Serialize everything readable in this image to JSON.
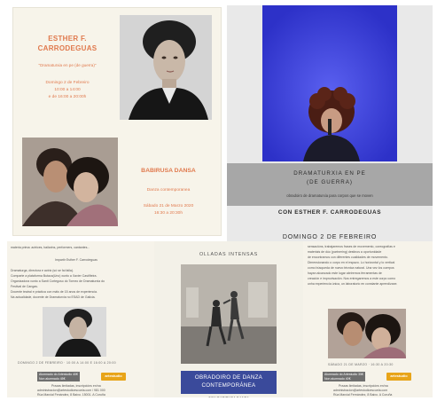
{
  "poster1": {
    "name_line1": "ESTHER F.",
    "name_line2": "CARRODEGUAS",
    "workshop_title": "\"Dramaturxia en pe (de guerra)\"",
    "date": "Domingo 2 de Febreiro",
    "time1": "10:00 a 14:00",
    "time2": "e de 16:00 a 20:00h",
    "company": "BABIRUSA DANSA",
    "genre": "Danza contemporanea",
    "date2": "Sábado 21 de Marzo 2020",
    "time3": "16:30 a 20:30h"
  },
  "poster2": {
    "title_line1": "DRAMATURXIA EN PE",
    "title_line2": "(DE GUERRA)",
    "subtitle": "obradoiro de dramaturxia para corpos que se moven",
    "instructor": "CON ESTHER F. CARRODEGUAS",
    "date": "DOMINGO 2 DE FEBREIRO"
  },
  "poster3": {
    "top_line": "materia prima: actrices, bailarins, performers, cantantes...",
    "impartido": "Impartir Esther F. Carrodeguas",
    "bio1": "Dramaturga, directora e actriz (só se fai falla).",
    "bio2": "Comparte a plataforma Butaca(Uno) xunto a Xavier Castiñeira.",
    "bio3": "Organizadora xunto a Santi Cortegoso do Torneo de Dramaturxia do",
    "bio4": "Festival de Cangas.",
    "bio5": "Docente teatral e práctica con máis de 15 anos de experiencia.",
    "bio6": "Na actualidade, docente de Dramaturxia no ESAD de Galicia.",
    "schedule": "DOMINGO 2 DE FEBREIRO · 10:00 A 14:00 E 16:00 A 20:00",
    "price1": "Alumnado do Artestudio 40€",
    "price2": "Non alumnado 45€",
    "logo": "artestudio",
    "footer1": "Prazas limitadas, inscripcións en/na",
    "footer2": "administracion@artestudioescuela.com / 981 000",
    "footer3": "Rúa Marcial Fenández, 8 Baixo. 15001. A Coruña"
  },
  "poster4": {
    "header": "OLLADAS INTENSAS",
    "title_line1": "OBRADOIRO DE DANZA",
    "title_line2": "CONTEMPORÁNEA",
    "footer": "CON BABIRUSA DANSA"
  },
  "poster5": {
    "text1": "sensacións, trabajaremos frases de movemento, coreografías e",
    "text2": "materiais de dúo (partnering) destinos a oportunidade",
    "text3": "de encontramos con diferentes cualidades de movemento.",
    "text4": "Dimensionando o corpo en el espazo. Lo horizontal y lo vertical",
    "text5": "como búsqueda de nuevo técnica natural. Una vez los cuerpos",
    "text6": "hayan alcanzado este lugar abriremos ferramentas de",
    "text7": "creación e improvisación. Nos entregaremos a este corpo como",
    "text8": "unha experiencia única, un laboratorio en constante aprendizaxe.",
    "schedule": "SÁBADO 21 DE MARZO · 16:30 A 20:30",
    "price1": "Alumnado do Artestudio 35€",
    "price2": "Non alumnado 40€",
    "logo": "artestudio",
    "footer1": "Prazas limitadas, inscripcións en/na",
    "footer2": "administracion@artestudioescuela.com",
    "footer3": "Rúa Marcial Fernández, 8 Baixo. A Coruña"
  },
  "colors": {
    "accent_orange": "#e0794d",
    "stage_blue": "#3b40d8",
    "band_grey": "#a7a7a7",
    "title_navy": "#3a4a9b"
  }
}
